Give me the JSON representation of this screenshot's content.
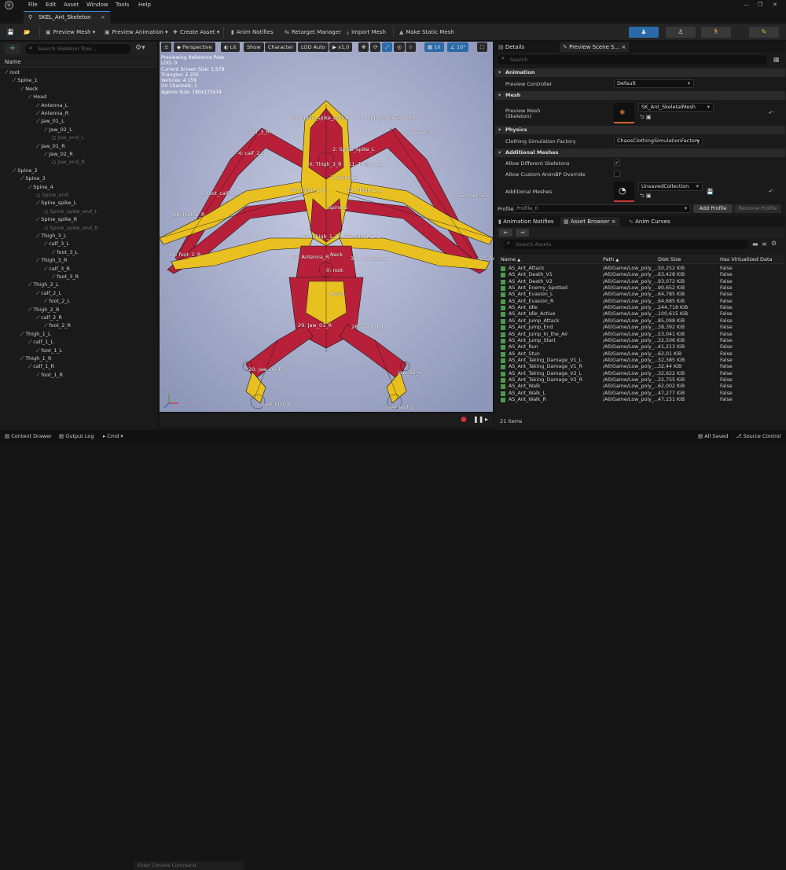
{
  "menubar": {
    "items": [
      "File",
      "Edit",
      "Asset",
      "Window",
      "Tools",
      "Help"
    ]
  },
  "tab": {
    "title": "SKEL_Ant_Skeleton",
    "close": "×"
  },
  "toolbar": {
    "preview_mesh": "Preview Mesh",
    "preview_animation": "Preview Animation",
    "create_asset": "Create Asset",
    "anim_notifies": "Anim Notifies",
    "retarget_manager": "Retarget Manager",
    "import_mesh": "Import Mesh",
    "make_static_mesh": "Make Static Mesh"
  },
  "skeleton_tree": {
    "search_placeholder": "Search Skeleton Tree...",
    "column_name": "Name",
    "bones": [
      {
        "label": "root",
        "depth": 0,
        "dim": false
      },
      {
        "label": "Spine_1",
        "depth": 1,
        "dim": false
      },
      {
        "label": "Neck",
        "depth": 2,
        "dim": false
      },
      {
        "label": "Head",
        "depth": 3,
        "dim": false
      },
      {
        "label": "Antenna_L",
        "depth": 4,
        "dim": false
      },
      {
        "label": "Antenna_R",
        "depth": 4,
        "dim": false
      },
      {
        "label": "Jaw_01_L",
        "depth": 4,
        "dim": false
      },
      {
        "label": "Jaw_02_L",
        "depth": 5,
        "dim": false
      },
      {
        "label": "Jaw_end_L",
        "depth": 6,
        "dim": true
      },
      {
        "label": "Jaw_01_R",
        "depth": 4,
        "dim": false
      },
      {
        "label": "Jaw_02_R",
        "depth": 5,
        "dim": false
      },
      {
        "label": "Jaw_end_R",
        "depth": 6,
        "dim": true
      },
      {
        "label": "Spine_2",
        "depth": 1,
        "dim": false
      },
      {
        "label": "Spine_3",
        "depth": 2,
        "dim": false
      },
      {
        "label": "Spine_4",
        "depth": 3,
        "dim": false
      },
      {
        "label": "Spine_end",
        "depth": 4,
        "dim": true
      },
      {
        "label": "Spine_spike_L",
        "depth": 4,
        "dim": false
      },
      {
        "label": "Spine_spike_end_L",
        "depth": 5,
        "dim": true
      },
      {
        "label": "Spine_spike_R",
        "depth": 4,
        "dim": false
      },
      {
        "label": "Spine_spike_end_R",
        "depth": 5,
        "dim": true
      },
      {
        "label": "Thigh_3_L",
        "depth": 4,
        "dim": false
      },
      {
        "label": "calf_3_L",
        "depth": 5,
        "dim": false
      },
      {
        "label": "foot_3_L",
        "depth": 6,
        "dim": false
      },
      {
        "label": "Thigh_3_R",
        "depth": 4,
        "dim": false
      },
      {
        "label": "calf_3_R",
        "depth": 5,
        "dim": false
      },
      {
        "label": "foot_3_R",
        "depth": 6,
        "dim": false
      },
      {
        "label": "Thigh_2_L",
        "depth": 3,
        "dim": false
      },
      {
        "label": "calf_2_L",
        "depth": 4,
        "dim": false
      },
      {
        "label": "foot_2_L",
        "depth": 5,
        "dim": false
      },
      {
        "label": "Thigh_2_R",
        "depth": 3,
        "dim": false
      },
      {
        "label": "calf_2_R",
        "depth": 4,
        "dim": false
      },
      {
        "label": "foot_2_R",
        "depth": 5,
        "dim": false
      },
      {
        "label": "Thigh_1_L",
        "depth": 2,
        "dim": false
      },
      {
        "label": "calf_1_L",
        "depth": 3,
        "dim": false
      },
      {
        "label": "foot_1_L",
        "depth": 4,
        "dim": false
      },
      {
        "label": "Thigh_1_R",
        "depth": 2,
        "dim": false
      },
      {
        "label": "calf_1_R",
        "depth": 3,
        "dim": false
      },
      {
        "label": "foot_1_R",
        "depth": 4,
        "dim": false
      }
    ]
  },
  "viewport": {
    "perspective": "Perspective",
    "lit": "Lit",
    "show": "Show",
    "character": "Character",
    "lod": "LOD Auto",
    "speed": "x1,0",
    "grid_value": "10",
    "angle_value": "10°",
    "info": [
      "Previewing Reference Pose",
      "LOD: 0",
      "Current Screen Size: 1,579",
      "Triangles: 2 205",
      "Vertices: 4 159",
      "UV Channels: 1",
      "Approx Size: 190x173x74"
    ],
    "bone_labels": [
      "10: Spine_spike_end_R",
      "11: Spine_spike_end_L",
      "7: calf_3_R",
      "12: calf_3_L",
      "4: calf_2_R",
      "2: Spine_spike_L",
      "9: Thigh_3_R",
      "11: Thigh_3_L",
      "5: Spine_3",
      "8: foot_calf_1_R",
      "15: foot_3_L",
      "16: Thigh_2_R",
      "19: Thigh_2_L",
      "18: foot_2_R",
      "Spine_2",
      "32: Thigh_1_R",
      "35: Thigh_1_L",
      "34: foot_1_R",
      "37: foot_1_L",
      "24: Antenna_R",
      "Neck",
      "31: Antenna_L",
      "0: root",
      "Head",
      "29: Jaw_01_R",
      "28: Jaw_01_L",
      "20: Jaw_02_R",
      "Jaw_02_L",
      "Jaw_end_R",
      "Jaw_end_L"
    ]
  },
  "details": {
    "tab_details": "Details",
    "tab_preview_scene": "Preview Scene S...",
    "search_placeholder": "Search",
    "sections": {
      "animation": "Animation",
      "mesh": "Mesh",
      "physics": "Physics",
      "additional_meshes": "Additional Meshes"
    },
    "preview_controller_label": "Preview Controller",
    "preview_controller_value": "Default",
    "preview_mesh_label": "Preview Mesh",
    "preview_mesh_sub": "(Skeleton)",
    "preview_mesh_value": "SK_Ant_SkeletalMesh",
    "clothing_label": "Clothing Simulation Factory",
    "clothing_value": "ChaosClothingSimulationFactory",
    "allow_diff_label": "Allow Different Skeletons",
    "allow_custom_label": "Allow Custom AnimBP Override",
    "additional_meshes_label": "Additional Meshes",
    "additional_meshes_value": "UnsavedCollection",
    "profile_label": "Profile",
    "profile_value": "Profile_0",
    "add_profile": "Add Profile",
    "remove_profile": "Remove Profile"
  },
  "asset_browser": {
    "tab_anim_notifies": "Animation Notifies",
    "tab_asset_browser": "Asset Browser",
    "tab_anim_curves": "Anim Curves",
    "search_placeholder": "Search Assets",
    "col_name": "Name",
    "col_path": "Path",
    "col_size": "Disk Size",
    "col_virt": "Has Virtualized Data",
    "rows": [
      {
        "name": "AS_Ant_Attack",
        "path": "/All/Game/Low_poly_...",
        "size": "50,252 KiB",
        "virt": "False"
      },
      {
        "name": "AS_Ant_Death_V1",
        "path": "/All/Game/Low_poly_...",
        "size": "63,428 KiB",
        "virt": "False"
      },
      {
        "name": "AS_Ant_Death_V2",
        "path": "/All/Game/Low_poly_...",
        "size": "93,072 KiB",
        "virt": "False"
      },
      {
        "name": "AS_Ant_Enemy_Spotted",
        "path": "/All/Game/Low_poly_...",
        "size": "90,652 KiB",
        "virt": "False"
      },
      {
        "name": "AS_Ant_Evasion_L",
        "path": "/All/Game/Low_poly_...",
        "size": "64,785 KiB",
        "virt": "False"
      },
      {
        "name": "AS_Ant_Evasion_R",
        "path": "/All/Game/Low_poly_...",
        "size": "64,685 KiB",
        "virt": "False"
      },
      {
        "name": "AS_Ant_Idle",
        "path": "/All/Game/Low_poly_...",
        "size": "244,718 KiB",
        "virt": "False"
      },
      {
        "name": "AS_Ant_Idle_Active",
        "path": "/All/Game/Low_poly_...",
        "size": "100,615 KiB",
        "virt": "False"
      },
      {
        "name": "AS_Ant_Jump_Attack",
        "path": "/All/Game/Low_poly_...",
        "size": "85,098 KiB",
        "virt": "False"
      },
      {
        "name": "AS_Ant_Jump_End",
        "path": "/All/Game/Low_poly_...",
        "size": "38,392 KiB",
        "virt": "False"
      },
      {
        "name": "AS_Ant_Jump_In_the_Air",
        "path": "/All/Game/Low_poly_...",
        "size": "53,041 KiB",
        "virt": "False"
      },
      {
        "name": "AS_Ant_Jump_Start",
        "path": "/All/Game/Low_poly_...",
        "size": "32,506 KiB",
        "virt": "False"
      },
      {
        "name": "AS_Ant_Run",
        "path": "/All/Game/Low_poly_...",
        "size": "41,213 KiB",
        "virt": "False"
      },
      {
        "name": "AS_Ant_Stun",
        "path": "/All/Game/Low_poly_...",
        "size": "62,01 KiB",
        "virt": "False"
      },
      {
        "name": "AS_Ant_Taking_Damage_V1_L",
        "path": "/All/Game/Low_poly_...",
        "size": "32,385 KiB",
        "virt": "False"
      },
      {
        "name": "AS_Ant_Taking_Damage_V1_R",
        "path": "/All/Game/Low_poly_...",
        "size": "32,44 KiB",
        "virt": "False"
      },
      {
        "name": "AS_Ant_Taking_Damage_V2_L",
        "path": "/All/Game/Low_poly_...",
        "size": "32,622 KiB",
        "virt": "False"
      },
      {
        "name": "AS_Ant_Taking_Damage_V2_R",
        "path": "/All/Game/Low_poly_...",
        "size": "32,755 KiB",
        "virt": "False"
      },
      {
        "name": "AS_Ant_Walk",
        "path": "/All/Game/Low_poly_...",
        "size": "62,002 KiB",
        "virt": "False"
      },
      {
        "name": "AS_Ant_Walk_L",
        "path": "/All/Game/Low_poly_...",
        "size": "47,277 KiB",
        "virt": "False"
      },
      {
        "name": "AS_Ant_Walk_R",
        "path": "/All/Game/Low_poly_...",
        "size": "47,151 KiB",
        "virt": "False"
      }
    ],
    "item_count": "21 items"
  },
  "statusbar": {
    "content_drawer": "Content Drawer",
    "output_log": "Output Log",
    "cmd": "Cmd",
    "console_placeholder": "Enter Console Command",
    "all_saved": "All Saved",
    "source_control": "Source Control"
  },
  "colors": {
    "accent": "#2a6aa8",
    "viewport_bg": "#9fa7c6",
    "ant_red": "#b8203a",
    "ant_yellow": "#e8c020"
  }
}
